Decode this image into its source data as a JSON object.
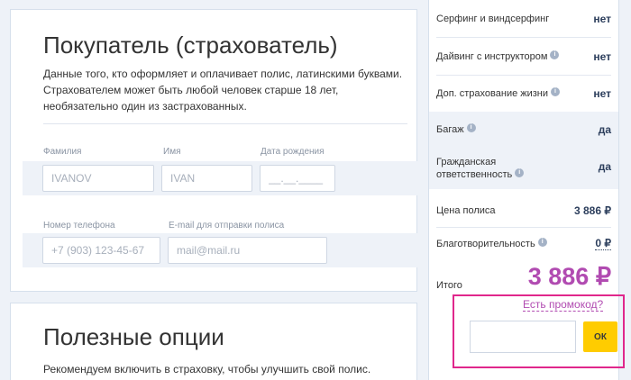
{
  "buyer": {
    "title": "Покупатель (страхователь)",
    "description": "Данные того, кто оформляет и оплачивает полис, латинскими буквами. Страхователем может быть любой человек старше 18 лет, необязательно один из застрахованных.",
    "fields": {
      "surname_label": "Фамилия",
      "surname_placeholder": "IVANOV",
      "name_label": "Имя",
      "name_placeholder": "IVAN",
      "dob_label": "Дата рождения",
      "dob_placeholder": "__.__.____",
      "phone_label": "Номер телефона",
      "phone_placeholder": "+7 (903) 123-45-67",
      "email_label": "E-mail для отправки полиса",
      "email_placeholder": "mail@mail.ru"
    }
  },
  "options": {
    "title": "Полезные опции",
    "description": "Рекомендуем включить в страховку, чтобы улучшить свой полис."
  },
  "summary": {
    "rows": [
      {
        "label": "Серфинг и виндсерфинг",
        "value": "нет",
        "info": false
      },
      {
        "label": "Дайвинг с инструктором",
        "value": "нет",
        "info": true
      },
      {
        "label": "Доп. страхование жизни",
        "value": "нет",
        "info": true
      },
      {
        "label": "Багаж",
        "value": "да",
        "info": true
      },
      {
        "label": "Гражданская ответственность",
        "value": "да",
        "info": true
      },
      {
        "label": "Цена полиса",
        "value": "3 886 ₽",
        "info": false
      },
      {
        "label": "Благотворительность",
        "value": "0 ₽",
        "info": true
      }
    ],
    "total_label": "Итого",
    "total_value": "3 886 ₽"
  },
  "promo": {
    "link_text": "Есть промокод?",
    "input_placeholder": "",
    "ok_label": "ОК"
  },
  "colors": {
    "accent": "#b14bb1",
    "highlight_border": "#e0278c",
    "ok_button": "#ffcc00"
  }
}
